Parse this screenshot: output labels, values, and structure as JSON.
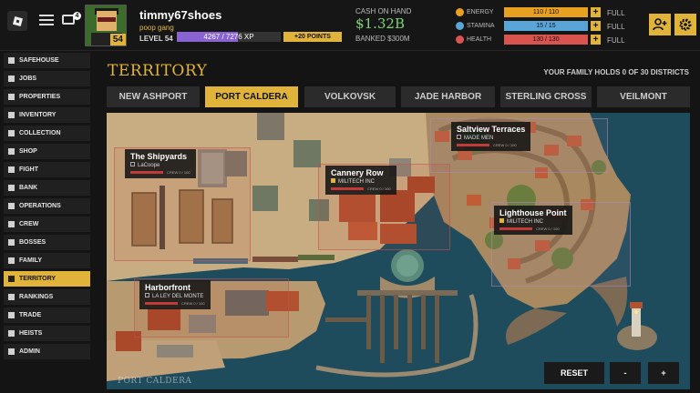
{
  "header": {
    "chat_badge": "4",
    "player": {
      "username": "timmy67shoes",
      "gang": "poop gang",
      "level_badge": "54",
      "level_label": "LEVEL 54"
    },
    "xp": {
      "text": "4267 / 7276 XP",
      "fraction": 0.586
    },
    "points_button": "+20 POINTS",
    "cash": {
      "label": "CASH ON HAND",
      "value": "$1.32B",
      "banked": "BANKED  $300M"
    },
    "stats": [
      {
        "name": "ENERGY",
        "value": "110 / 110",
        "fraction": 1.0,
        "color": "#e8a020",
        "status": "FULL"
      },
      {
        "name": "STAMINA",
        "value": "15 / 15",
        "fraction": 1.0,
        "color": "#5aa5d8",
        "status": "FULL"
      },
      {
        "name": "HEALTH",
        "value": "130 / 130",
        "fraction": 1.0,
        "color": "#d9534f",
        "status": "FULL"
      }
    ],
    "buttons": {
      "plus": "+"
    }
  },
  "sidebar": {
    "items": [
      {
        "label": "SAFEHOUSE",
        "icon": "house-icon",
        "active": false
      },
      {
        "label": "JOBS",
        "icon": "briefcase-icon",
        "active": false
      },
      {
        "label": "PROPERTIES",
        "icon": "building-icon",
        "active": false
      },
      {
        "label": "INVENTORY",
        "icon": "box-icon",
        "active": false
      },
      {
        "label": "COLLECTION",
        "icon": "collection-icon",
        "active": false
      },
      {
        "label": "SHOP",
        "icon": "cart-icon",
        "active": false
      },
      {
        "label": "FIGHT",
        "icon": "swords-icon",
        "active": false
      },
      {
        "label": "BANK",
        "icon": "bank-icon",
        "active": false
      },
      {
        "label": "OPERATIONS",
        "icon": "target-icon",
        "active": false
      },
      {
        "label": "CREW",
        "icon": "crew-icon",
        "active": false
      },
      {
        "label": "BOSSES",
        "icon": "crown-icon",
        "active": false
      },
      {
        "label": "FAMILY",
        "icon": "family-icon",
        "active": false
      },
      {
        "label": "TERRITORY",
        "icon": "flag-icon",
        "active": true
      },
      {
        "label": "RANKINGS",
        "icon": "chart-icon",
        "active": false
      },
      {
        "label": "TRADE",
        "icon": "trade-icon",
        "active": false
      },
      {
        "label": "HEISTS",
        "icon": "mask-icon",
        "active": false
      },
      {
        "label": "ADMIN",
        "icon": "shield-icon",
        "active": false
      }
    ]
  },
  "territory": {
    "title": "TERRITORY",
    "districts_info": "YOUR FAMILY HOLDS 0 OF 30 DISTRICTS",
    "tabs": [
      {
        "label": "NEW ASHPORT",
        "active": false
      },
      {
        "label": "PORT CALDERA",
        "active": true
      },
      {
        "label": "VOLKOVSK",
        "active": false
      },
      {
        "label": "JADE HARBOR",
        "active": false
      },
      {
        "label": "STERLING CROSS",
        "active": false
      },
      {
        "label": "VEILMONT",
        "active": false
      }
    ],
    "map_name": "PORT CALDERA",
    "districts": [
      {
        "name": "The Shipyards",
        "owner": "LaCoope",
        "crew": "CREW 0 / 100"
      },
      {
        "name": "Cannery Row",
        "owner": "MILITECH INC",
        "crew": "CREW 0 / 100"
      },
      {
        "name": "Saltview Terraces",
        "owner": "MADE MEN",
        "crew": "CREW 0 / 100"
      },
      {
        "name": "Lighthouse Point",
        "owner": "MILITECH INC",
        "crew": "CREW 0 / 100"
      },
      {
        "name": "Harborfront",
        "owner": "LA LEY DEL MONTE",
        "crew": "CREW 0 / 100"
      }
    ],
    "controls": {
      "reset": "RESET",
      "zoom_out": "-",
      "zoom_in": "+"
    },
    "colors": {
      "accent": "#e0b43a",
      "water": "#1d4a5a",
      "land": "#c9ad82",
      "roof": "#b3522f"
    }
  }
}
